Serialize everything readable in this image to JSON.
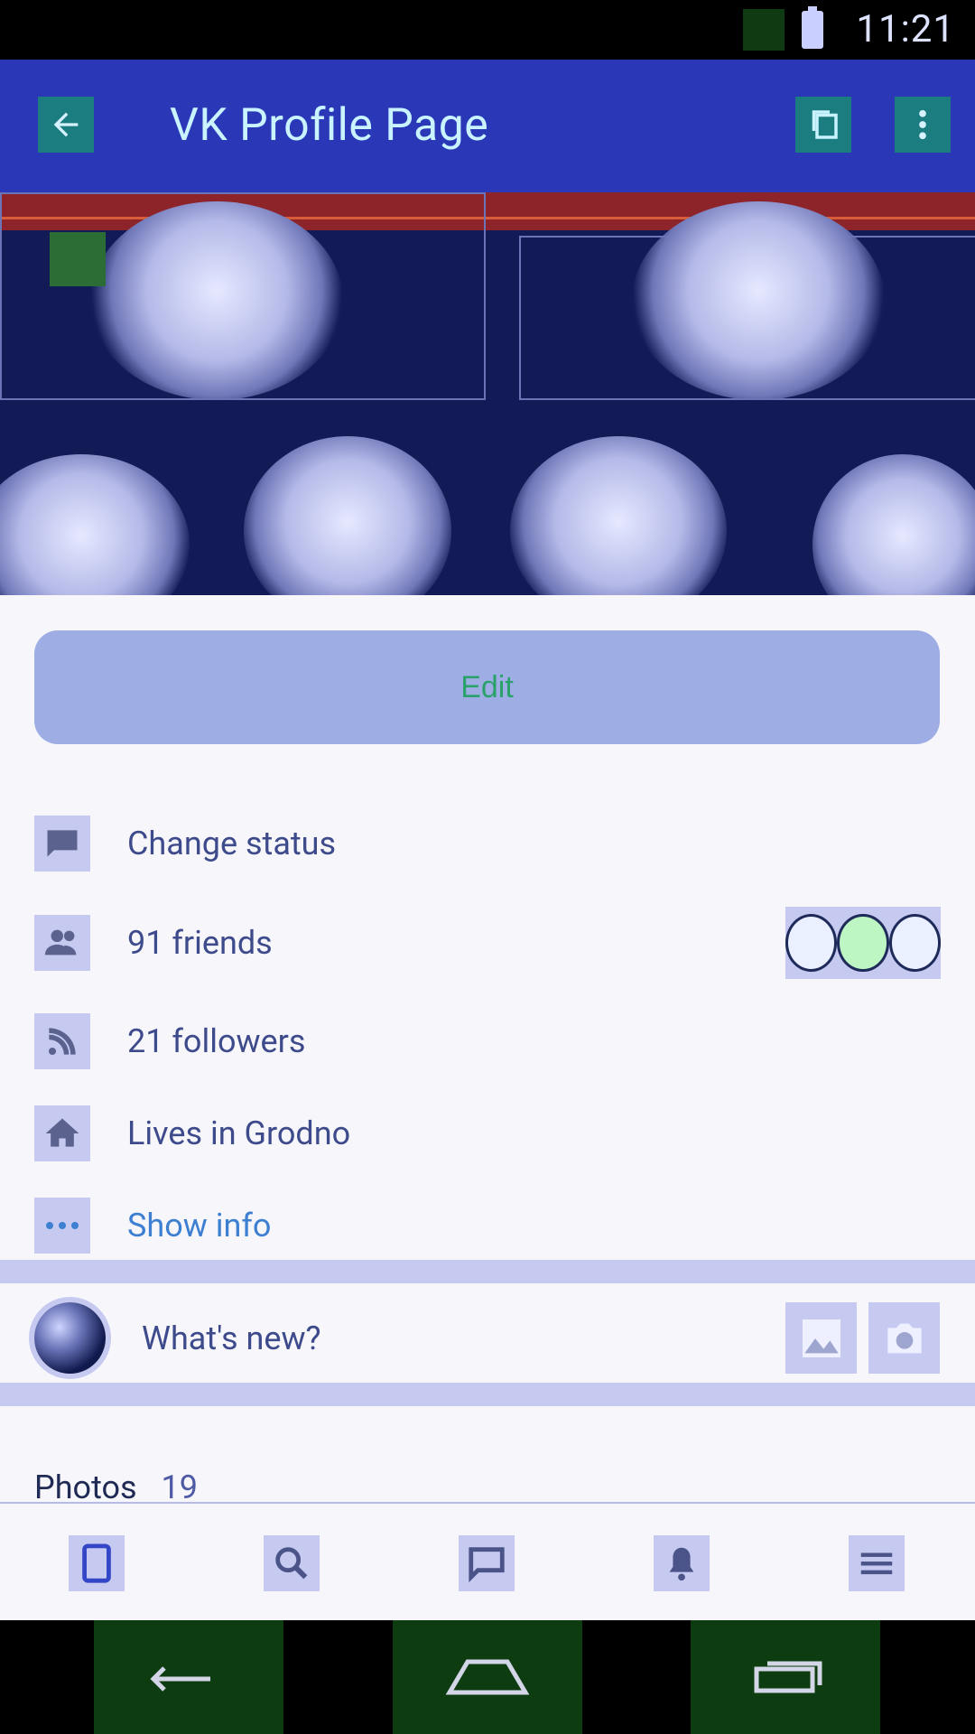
{
  "status": {
    "time": "11:21"
  },
  "appbar": {
    "title": "VK Profile Page"
  },
  "profile": {
    "edit_label": "Edit",
    "rows": [
      {
        "label": "Change status"
      },
      {
        "label": "91 friends"
      },
      {
        "label": "21 followers"
      },
      {
        "label": "Lives in Grodno"
      },
      {
        "label": "Show info"
      }
    ]
  },
  "composer": {
    "prompt": "What's new?"
  },
  "photos": {
    "label": "Photos",
    "count": "19"
  },
  "colors": {
    "appbar": "#2a37b7",
    "accent": "#3d7fd1",
    "edit_button": "#9eaee5",
    "edit_text": "#2aa16b"
  },
  "icons": {
    "back": "arrow-left-icon",
    "copy": "copy-icon",
    "more": "more-vertical-icon",
    "status": "chat-bubble-icon",
    "friends": "people-icon",
    "followers": "rss-icon",
    "home": "home-icon",
    "info": "dots-icon",
    "image": "image-icon",
    "camera": "camera-icon",
    "tabs": [
      "profile-icon",
      "search-icon",
      "messages-icon",
      "notifications-icon",
      "menu-icon"
    ]
  }
}
